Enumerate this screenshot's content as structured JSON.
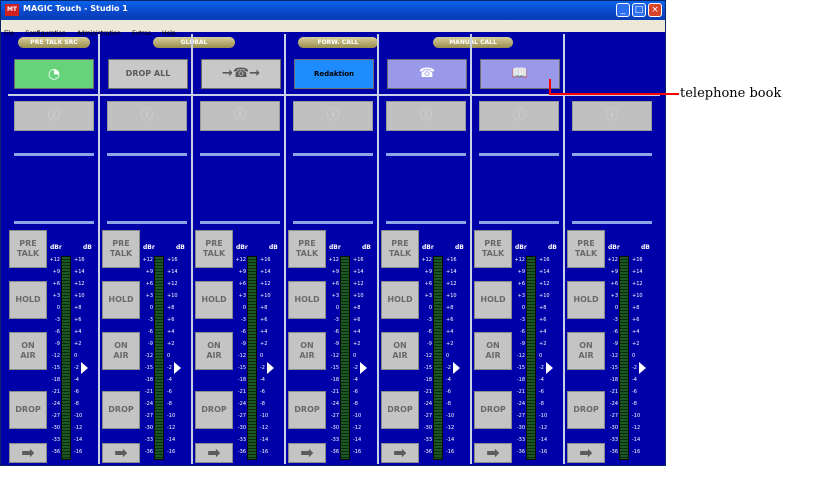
{
  "window": {
    "title": "MAGIC Touch - Studio 1",
    "app_icon": "MT",
    "buttons": [
      "min-icon",
      "max-icon",
      "close-icon"
    ]
  },
  "menu": [
    "File",
    "Configuration",
    "Administration",
    "Extras",
    "Help"
  ],
  "sections": [
    {
      "label": "PRE TALK SRC"
    },
    {
      "label": "GLOBAL"
    },
    {
      "label": "FORW. CALL"
    },
    {
      "label": "MANUAL CALL"
    }
  ],
  "top_buttons": {
    "pretalk_src": "◔",
    "drop_all": "DROP ALL",
    "transfer": "→☎→",
    "redaktion": "Redaktion",
    "manual_call": "☎",
    "phonebook": "📖"
  },
  "info_glyph": "ⓘ",
  "strip_buttons": {
    "pre_talk": "PRE\nTALK",
    "hold": "HOLD",
    "on_air": "ON\nAIR",
    "drop": "DROP",
    "forward": "➡"
  },
  "meter": {
    "unit_left": "dBr",
    "unit_right": "dB",
    "left_ticks": [
      "+12",
      "+9",
      "+6",
      "+3",
      "0",
      "-3",
      "-6",
      "-9",
      "-12",
      "-15",
      "-18",
      "-21",
      "-24",
      "-27",
      "-30",
      "-33",
      "-36"
    ],
    "right_ticks": [
      "+16",
      "+14",
      "+12",
      "+10",
      "+8",
      "+6",
      "+4",
      "+2",
      "0",
      "-2",
      "-4",
      "-6",
      "-8",
      "-10",
      "-12",
      "-14",
      "-16"
    ],
    "level_db": 0
  },
  "annotation": {
    "label": "telephone book"
  }
}
